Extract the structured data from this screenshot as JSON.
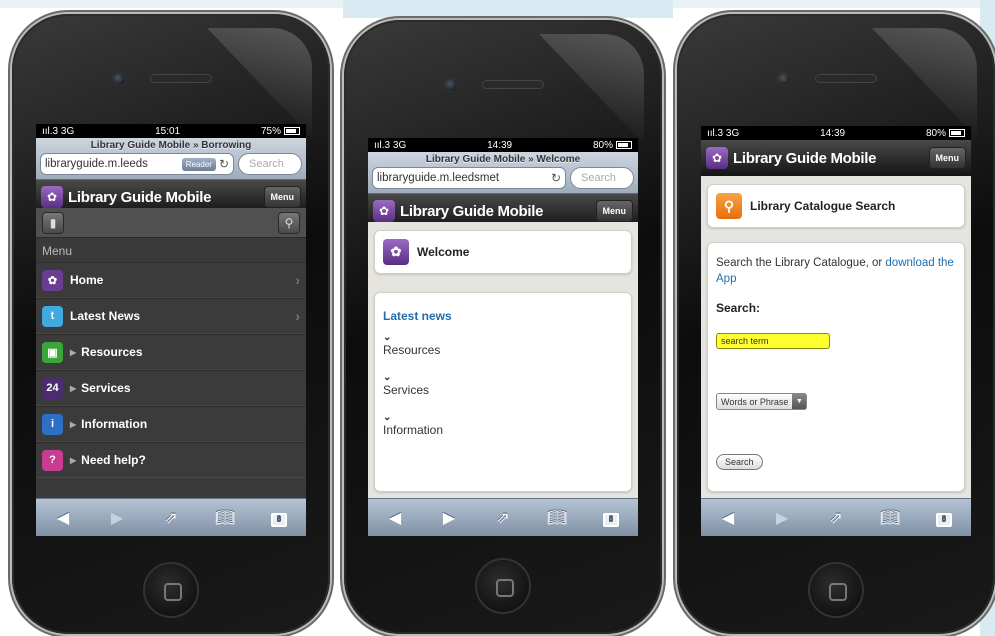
{
  "phones": [
    {
      "status": {
        "signal": "ııl.3 3G",
        "time": "15:01",
        "battery": "75%"
      },
      "page_title": "Library Guide Mobile » Borrowing",
      "url": "libraryguide.m.leeds",
      "reader_label": "Reader",
      "search_placeholder": "Search",
      "app_title": "Library Guide Mobile",
      "menu_button": "Menu",
      "menu_heading": "Menu",
      "menu_items": [
        {
          "label": "Home",
          "icon": "flower-logo-icon",
          "color": "#6a3d92",
          "glyph": "✿",
          "chevron": true,
          "triangle": false
        },
        {
          "label": "Latest News",
          "icon": "twitter-bird-icon",
          "color": "#3fa9e0",
          "glyph": "t",
          "chevron": true,
          "triangle": false
        },
        {
          "label": "Resources",
          "icon": "computer-screen-icon",
          "color": "#3aa53a",
          "glyph": "▣",
          "chevron": false,
          "triangle": true
        },
        {
          "label": "Services",
          "icon": "24-seven-icon",
          "color": "#4b2c6f",
          "glyph": "24",
          "chevron": false,
          "triangle": true
        },
        {
          "label": "Information",
          "icon": "info-icon",
          "color": "#2e6fc6",
          "glyph": "i",
          "chevron": false,
          "triangle": true
        },
        {
          "label": "Need help?",
          "icon": "help-question-icon",
          "color": "#c83c92",
          "glyph": "?",
          "chevron": false,
          "triangle": true
        }
      ],
      "tabs_count": "8"
    },
    {
      "status": {
        "signal": "ııl.3 3G",
        "time": "14:39",
        "battery": "80%"
      },
      "page_title": "Library Guide Mobile » Welcome",
      "url": "libraryguide.m.leedsmet",
      "search_placeholder": "Search",
      "app_title": "Library Guide Mobile",
      "menu_button": "Menu",
      "welcome_title": "Welcome",
      "latest_news": "Latest news",
      "sections": [
        "Resources",
        "Services",
        "Information"
      ],
      "tabs_count": "8"
    },
    {
      "status": {
        "signal": "ııl.3 3G",
        "time": "14:39",
        "battery": "80%"
      },
      "app_title": "Library Guide Mobile",
      "menu_button": "Menu",
      "catalogue_title": "Library Catalogue Search",
      "intro_text": "Search the Library Catalogue, or ",
      "intro_link": "download the App",
      "search_label": "Search:",
      "search_value": "search term",
      "select_value": "Words or Phrase",
      "search_button": "Search",
      "tabs_count": "8"
    }
  ],
  "colors": {
    "background_band": "#d9eaf2",
    "link": "#1f6db1",
    "purple_brand": "#5a2d82",
    "highlight_input": "#ffff30"
  }
}
